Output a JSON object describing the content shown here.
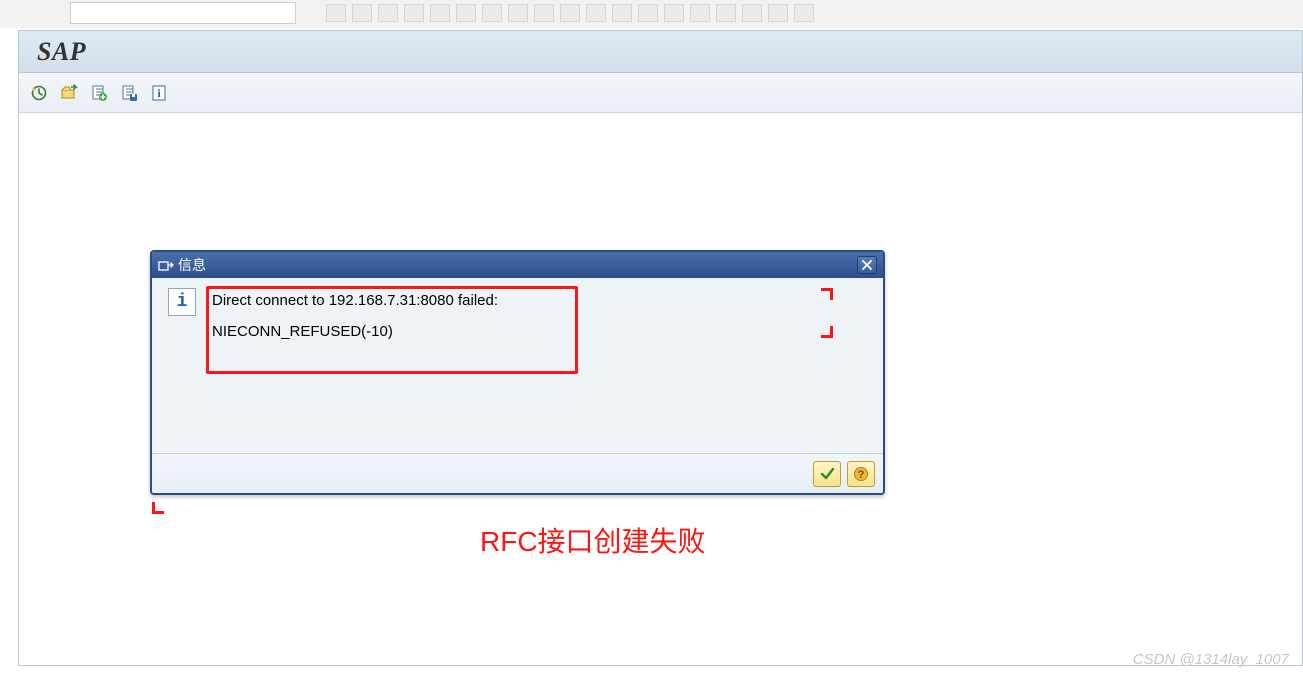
{
  "header": {
    "app_title": "SAP"
  },
  "modal": {
    "title": "信息",
    "message_line1": "Direct connect to 192.168.7.31:8080 failed:",
    "message_line2": "NIECONN_REFUSED(-10)"
  },
  "annotation": {
    "caption": "RFC接口创建失败"
  },
  "watermark": "CSDN @1314lay_1007",
  "icons": {
    "export": "export-icon",
    "clock": "clock-refresh-icon",
    "folder_arrow": "folder-arrow-icon",
    "add_page": "add-page-icon",
    "save": "save-icon",
    "info": "info-icon",
    "check": "confirm-check-icon",
    "help": "help-question-icon",
    "close": "close-x-icon"
  }
}
